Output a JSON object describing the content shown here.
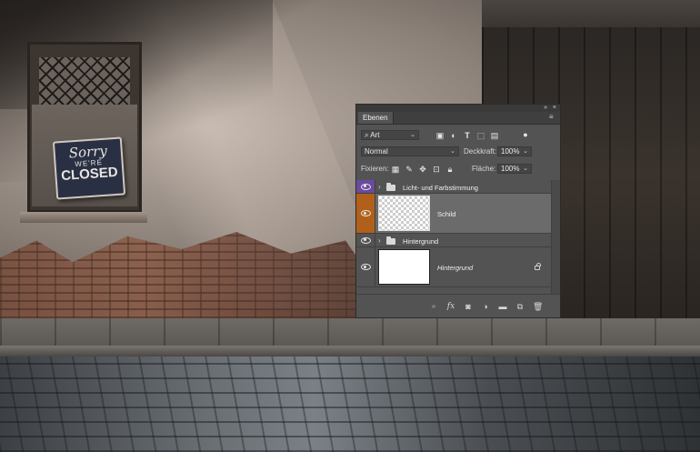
{
  "panel": {
    "tab_label": "Ebenen",
    "collapse_glyph": "»",
    "close_glyph": "×",
    "menu_glyph": "≡",
    "filter": {
      "value": "Art",
      "icon": "search-icon"
    },
    "blend": {
      "value": "Normal"
    },
    "opacity": {
      "label": "Deckkraft:",
      "value": "100%"
    },
    "lock": {
      "label": "Fixieren:"
    },
    "fill": {
      "label": "Fläche:",
      "value": "100%"
    },
    "layers": [
      {
        "name": "Licht- und Farbstimmung",
        "type": "group",
        "eye_color": "#6a4aa0",
        "selected": false
      },
      {
        "name": "Schild",
        "type": "pixel",
        "eye_color": "#b0601a",
        "selected": true
      },
      {
        "name": "Hintergrund",
        "type": "group",
        "eye_color": "",
        "selected": false
      },
      {
        "name": "Hintergrund",
        "type": "background",
        "eye_color": "",
        "selected": false,
        "locked": true
      }
    ]
  },
  "scene": {
    "sign": {
      "line1": "Sorry",
      "line2": "WE'RE",
      "line3": "CLOSED"
    }
  },
  "colors": {
    "panel_bg": "#535353",
    "selected_row": "#6b6b6b",
    "purple_eye": "#6a4aa0",
    "orange_eye": "#b0601a"
  }
}
